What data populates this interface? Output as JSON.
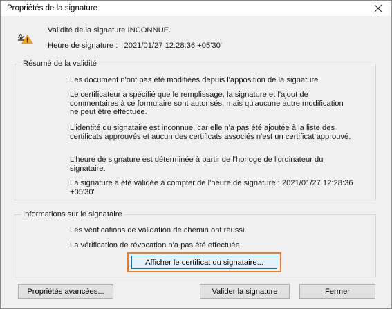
{
  "window": {
    "title": "Propriétés de la signature",
    "close_icon": "close-icon"
  },
  "header": {
    "icon": "signature-warning-icon",
    "status": "Validité de la signature INCONNUE.",
    "time_label": "Heure de signature :",
    "time_value": "2021/01/27 12:28:36 +05'30'"
  },
  "validity_summary": {
    "legend": "Résumé de la validité",
    "paragraphs": [
      "Les document n'ont pas été modifiées depuis l'apposition de la signature.",
      "Le certificateur a spécifié que le remplissage, la signature et l'ajout de commentaires à ce formulaire sont autorisés, mais qu'aucune autre modification ne peut être effectuée.",
      "L'identité du signataire est inconnue, car elle n'a pas été ajoutée à la liste des certificats approuvés et aucun des certificats associés n'est un certificat approuvé.",
      "L'heure de signature est déterminée à partir de l'horloge de l'ordinateur du signataire.",
      "La signature a été validée à compter de l'heure de signature : 2021/01/27 12:28:36 +05'30'"
    ]
  },
  "signer_info": {
    "legend": "Informations sur le signataire",
    "lines": [
      "Les vérifications de validation de chemin ont réussi.",
      "La vérification de révocation n'a pas été effectuée."
    ],
    "show_certificate_button": "Afficher le certificat du signataire..."
  },
  "footer": {
    "advanced_button": "Propriétés avancées...",
    "validate_button": "Valider la signature",
    "close_button": "Fermer"
  },
  "colors": {
    "highlight_frame": "#f07c28",
    "focused_button_border": "#0078d7",
    "warning_icon": "#f5a623"
  }
}
